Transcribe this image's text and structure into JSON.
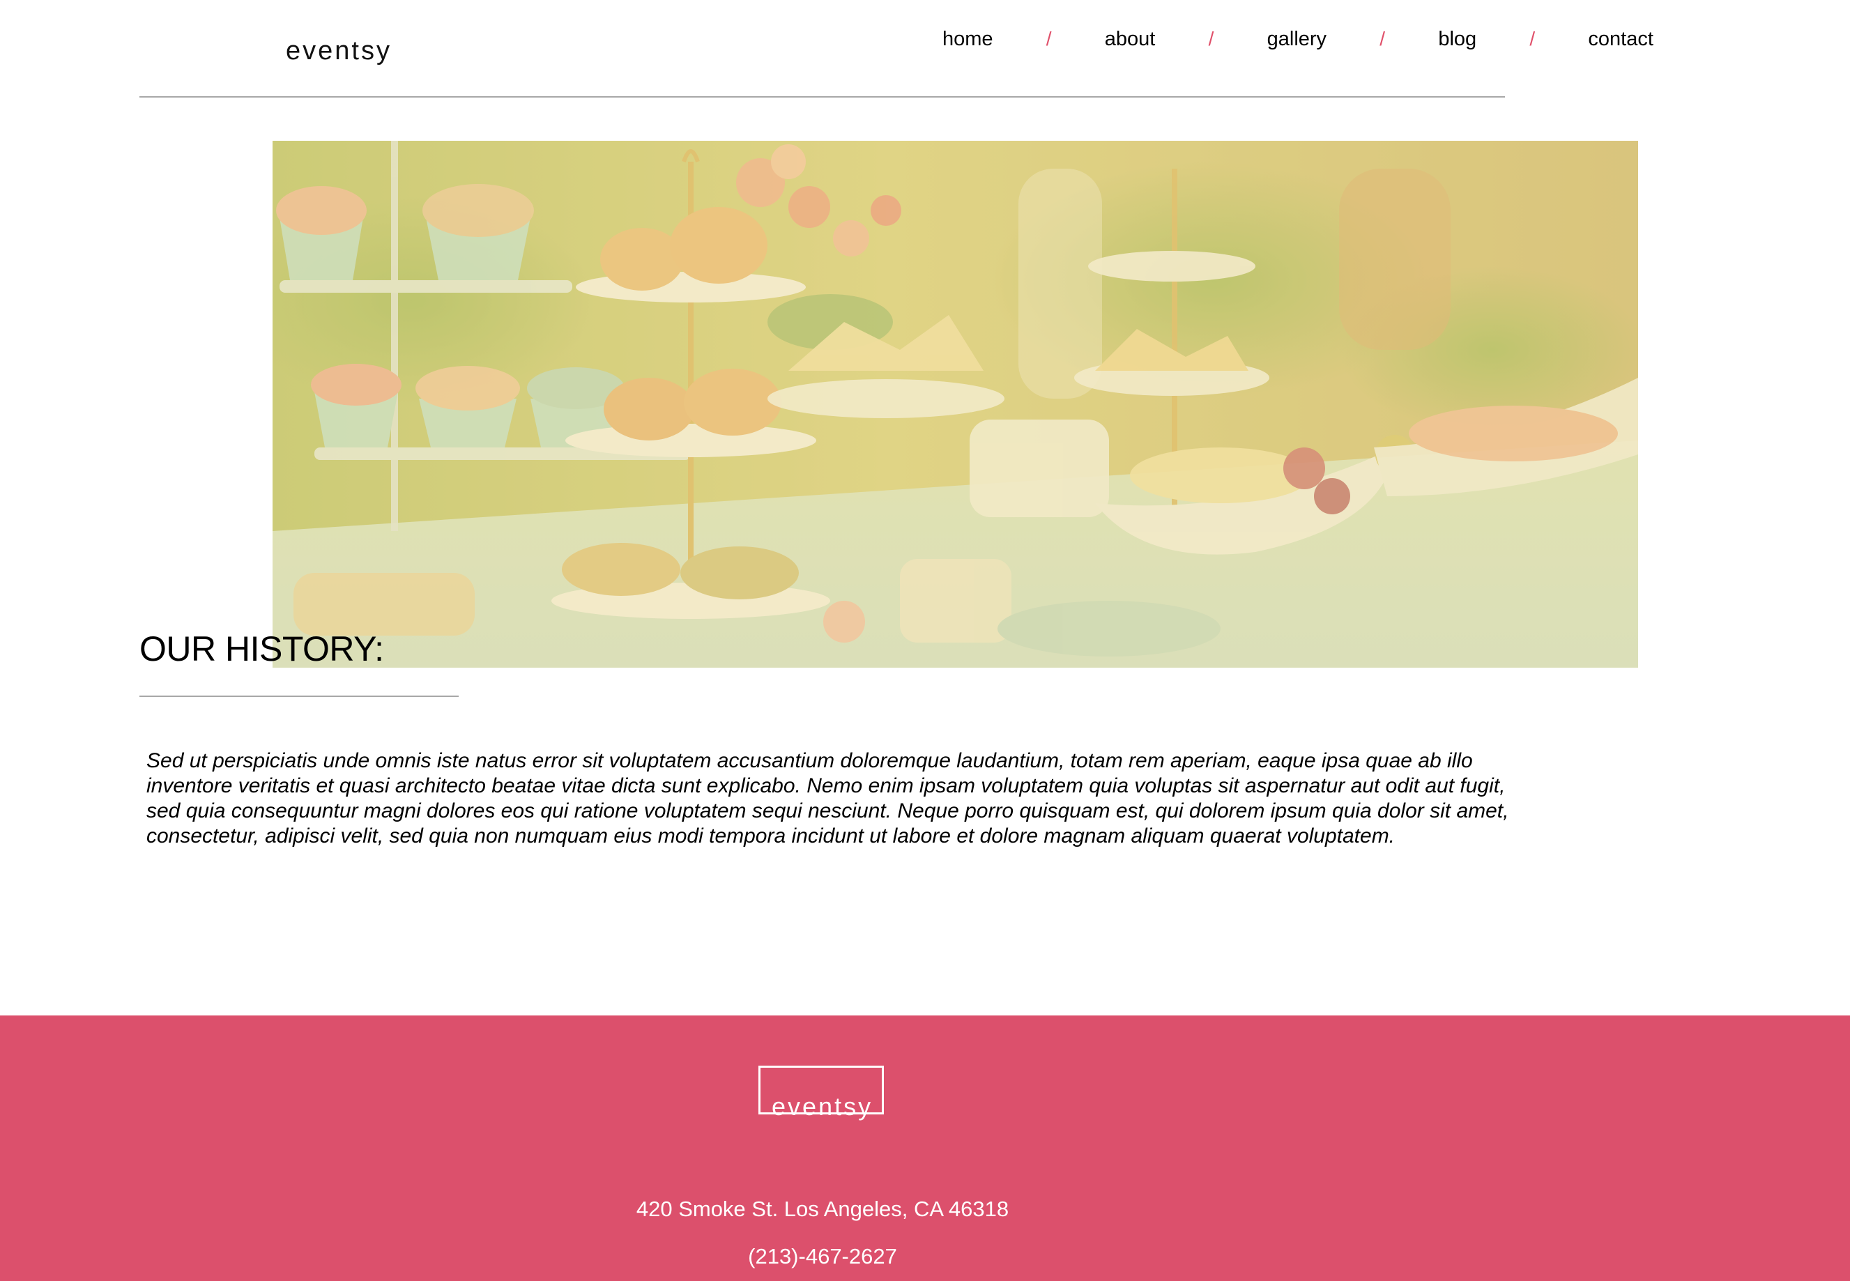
{
  "brand": {
    "name": "eventsy"
  },
  "nav": {
    "items": [
      {
        "label": "home"
      },
      {
        "label": "about"
      },
      {
        "label": "gallery"
      },
      {
        "label": "blog"
      },
      {
        "label": "contact"
      }
    ],
    "separator": "/"
  },
  "history": {
    "title": "OUR HISTORY:",
    "body": "Sed ut perspiciatis unde omnis iste natus error sit voluptatem accusantium doloremque laudantium, totam rem aperiam, eaque ipsa quae ab illo inventore veritatis et quasi architecto beatae vitae dicta sunt explicabo. Nemo enim ipsam voluptatem quia voluptas sit aspernatur aut odit aut fugit, sed quia consequuntur magni dolores eos qui ratione voluptatem sequi nesciunt. Neque porro quisquam est, qui dolorem ipsum quia dolor sit amet, consectetur, adipisci velit, sed quia non numquam eius modi tempora incidunt ut labore et dolore magnam aliquam quaerat voluptatem."
  },
  "footer": {
    "logo": "eventsy",
    "address": "420 Smoke St. Los Angeles, CA 46318",
    "phone": "(213)-467-2627"
  },
  "colors": {
    "accent": "#dc506c",
    "rule": "#a8a8a8",
    "hero_overlay": "#e8d88a"
  }
}
